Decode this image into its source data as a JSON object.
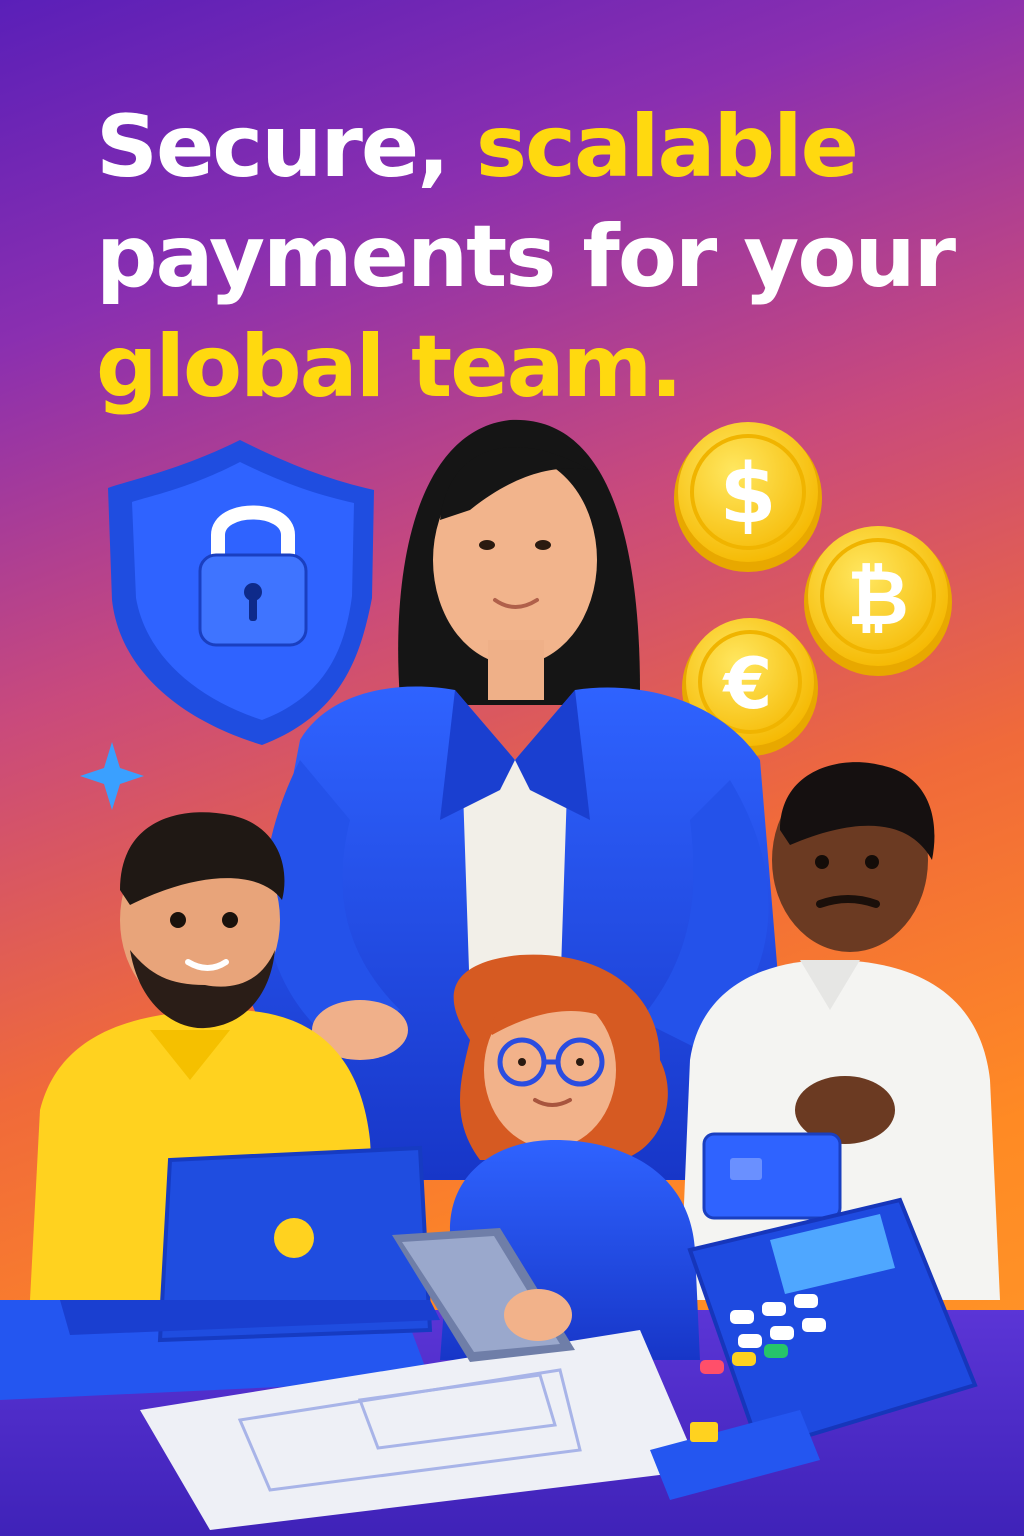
{
  "headline": {
    "line1_white": "Secure, ",
    "line1_yellow": "scalable",
    "line2_white": "payments for your",
    "line3_yellow": "global team."
  },
  "coins": {
    "dollar_symbol": "$",
    "bitcoin_symbol": "₿",
    "euro_symbol": "€"
  },
  "colors": {
    "accent_yellow": "#ffd90f",
    "brand_blue": "#1f4de0",
    "gradient_top": "#5a1fb8",
    "gradient_bottom": "#ff9a2a"
  },
  "icons": [
    "shield-lock-icon",
    "dollar-coin-icon",
    "bitcoin-coin-icon",
    "euro-coin-icon",
    "sparkle-icon",
    "laptop-icon",
    "tablet-icon",
    "card-terminal-icon",
    "credit-card-icon"
  ]
}
